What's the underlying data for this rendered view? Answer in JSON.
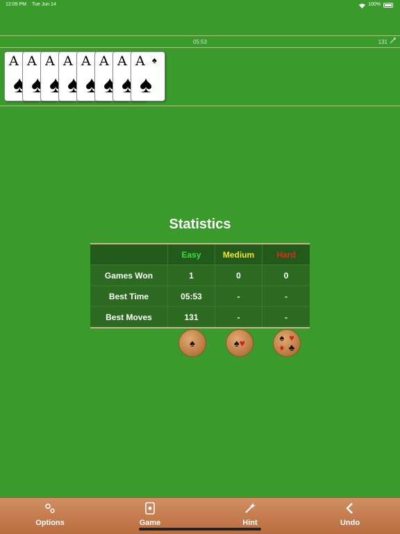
{
  "status_bar": {
    "time": "12:09 PM",
    "date": "Tue Jun 14",
    "battery": "100%"
  },
  "game_info": {
    "timer": "05:53",
    "moves": "131"
  },
  "foundation": {
    "cards": [
      {
        "rank": "A",
        "suit": "♠"
      },
      {
        "rank": "A",
        "suit": "♠"
      },
      {
        "rank": "A",
        "suit": "♠"
      },
      {
        "rank": "A",
        "suit": "♠"
      },
      {
        "rank": "A",
        "suit": "♠"
      },
      {
        "rank": "A",
        "suit": "♠"
      },
      {
        "rank": "A",
        "suit": "♠"
      },
      {
        "rank": "A",
        "suit": "♠"
      }
    ]
  },
  "statistics": {
    "title": "Statistics",
    "headers": {
      "easy": "Easy",
      "medium": "Medium",
      "hard": "Hard"
    },
    "rows": [
      {
        "label": "Games Won",
        "easy": "1",
        "medium": "0",
        "hard": "0"
      },
      {
        "label": "Best Time",
        "easy": "05:53",
        "medium": "-",
        "hard": "-"
      },
      {
        "label": "Best Moves",
        "easy": "131",
        "medium": "-",
        "hard": "-"
      }
    ],
    "colors": {
      "easy": "#38e040",
      "medium": "#f2e72c",
      "hard": "#e02a1c"
    }
  },
  "toolbar": {
    "options": "Options",
    "game": "Game",
    "hint": "Hint",
    "undo": "Undo"
  }
}
